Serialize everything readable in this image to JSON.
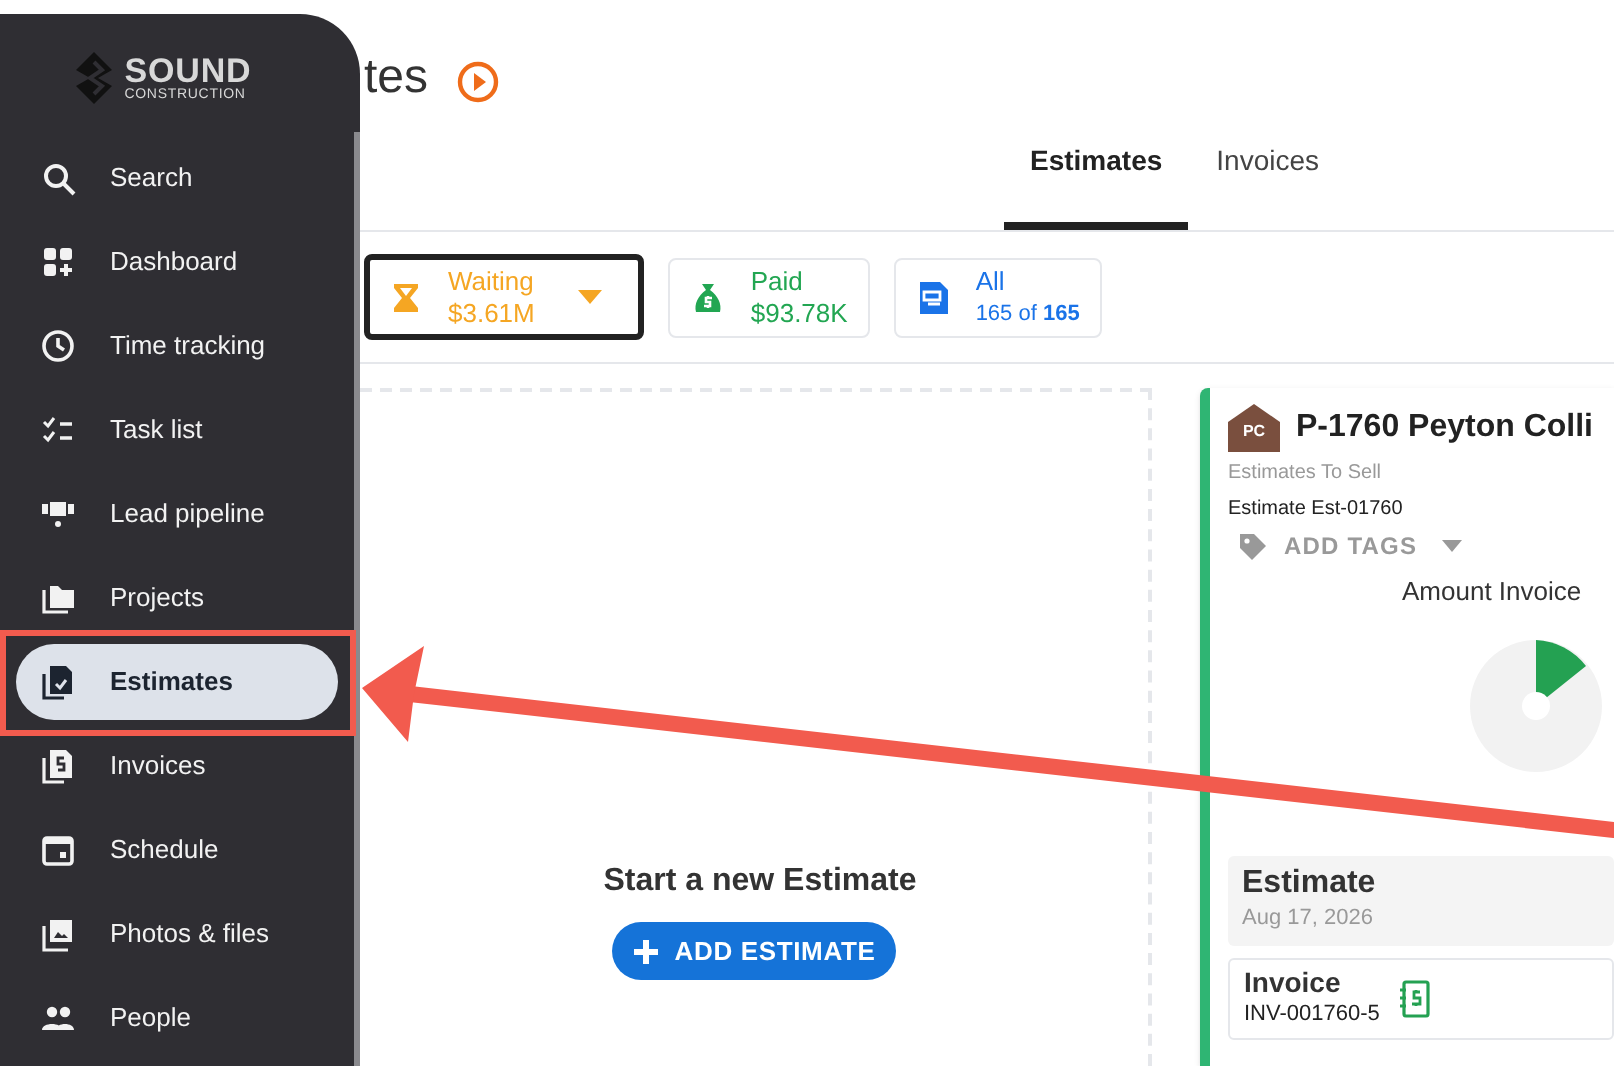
{
  "logo": {
    "name": "SOUND",
    "tagline": "CONSTRUCTION"
  },
  "page_title": "tes",
  "nav": [
    {
      "label": "Search",
      "kind": "search",
      "selected": false
    },
    {
      "label": "Dashboard",
      "kind": "dashboard",
      "selected": false
    },
    {
      "label": "Time tracking",
      "kind": "clock",
      "selected": false
    },
    {
      "label": "Task list",
      "kind": "tasks",
      "selected": false
    },
    {
      "label": "Lead pipeline",
      "kind": "pipeline",
      "selected": false
    },
    {
      "label": "Projects",
      "kind": "folder",
      "selected": false
    },
    {
      "label": "Estimates",
      "kind": "estimate",
      "selected": true
    },
    {
      "label": "Invoices",
      "kind": "invoice",
      "selected": false
    },
    {
      "label": "Schedule",
      "kind": "calendar",
      "selected": false
    },
    {
      "label": "Photos & files",
      "kind": "photos",
      "selected": false
    },
    {
      "label": "People",
      "kind": "people",
      "selected": false
    }
  ],
  "tabs": [
    {
      "label": "Estimates",
      "selected": true
    },
    {
      "label": "Invoices",
      "selected": false
    }
  ],
  "filters": [
    {
      "kind": "waiting",
      "label": "Waiting",
      "value": "$3.61M",
      "selected": true,
      "color": "#f5a623"
    },
    {
      "kind": "paid",
      "label": "Paid",
      "value": "$93.78K",
      "selected": false,
      "color": "#22a652"
    },
    {
      "kind": "all",
      "label": "All",
      "value": "165 of **165**",
      "selected": false,
      "color": "#1a73e8"
    }
  ],
  "empty_column": {
    "title": "Start a new Estimate",
    "button": "ADD ESTIMATE"
  },
  "card": {
    "badge": "PC",
    "title": "P-1760 Peyton Colli",
    "subtitle": "Estimates To Sell",
    "number": "Estimate Est-01760",
    "tags_button": "ADD TAGS",
    "chart_title": "Amount Invoice",
    "items": [
      {
        "kind": "estimate",
        "title": "Estimate",
        "subtitle": "Aug 17, 2026"
      },
      {
        "kind": "invoice",
        "title": "Invoice",
        "subtitle": "INV-001760-5"
      }
    ]
  }
}
